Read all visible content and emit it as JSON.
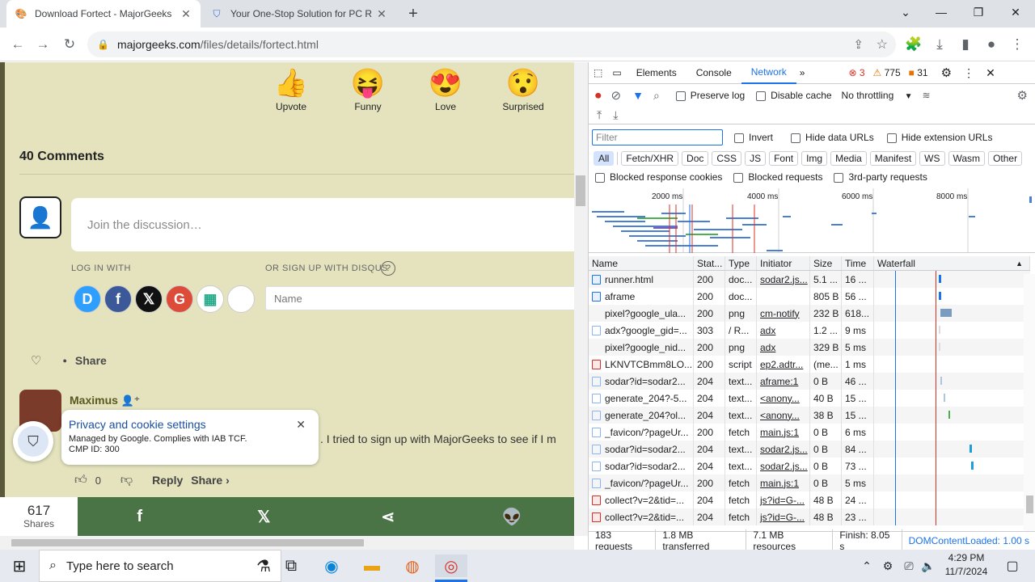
{
  "browser": {
    "tabs": [
      {
        "title": "Download Fortect - MajorGeeks",
        "active": true
      },
      {
        "title": "Your One-Stop Solution for PC R",
        "active": false
      }
    ],
    "new_tab_label": "+",
    "url_host": "majorgeeks.com",
    "url_path": "/files/details/fortect.html"
  },
  "page": {
    "reactions": [
      {
        "label": "Upvote",
        "emoji": "👍"
      },
      {
        "label": "Funny",
        "emoji": "😝"
      },
      {
        "label": "Love",
        "emoji": "😍"
      },
      {
        "label": "Surprised",
        "emoji": "😯"
      }
    ],
    "comments_title": "40 Comments",
    "join_placeholder": "Join the discussion…",
    "login_with": "LOG IN WITH",
    "signup_disqus": "OR SIGN UP WITH DISQUS",
    "help_mark": "?",
    "social": [
      {
        "label": "D",
        "color": "#2e9fff"
      },
      {
        "label": "f",
        "color": "#3b5998"
      },
      {
        "label": "𝕏",
        "color": "#111111"
      },
      {
        "label": "G",
        "color": "#dd4b39"
      },
      {
        "label": "▦",
        "color": "#ffffff"
      },
      {
        "label": "",
        "color": "#111111"
      }
    ],
    "name_placeholder": "Name",
    "share_label": "Share",
    "comment_author": "Maximus",
    "comment_text": ". I tried to sign up with MajorGeeks to see if I m",
    "vote_count": "0",
    "reply_label": "Reply",
    "share_link_label": "Share ›",
    "cookie_title": "Privacy and cookie settings",
    "cookie_sub1": "Managed by Google. Complies with IAB TCF.",
    "cookie_sub2": "CMP ID: 300",
    "share_count": "617",
    "share_count_label": "Shares",
    "share_buttons": [
      "f",
      "𝕏",
      "⋖",
      "👽"
    ]
  },
  "devtools": {
    "tabs": [
      "Elements",
      "Console",
      "Network"
    ],
    "active_tab": "Network",
    "errors": "3",
    "warnings": "775",
    "issues": "31",
    "preserve_log": "Preserve log",
    "disable_cache": "Disable cache",
    "throttling": "No throttling",
    "filter_placeholder": "Filter",
    "invert": "Invert",
    "hide_data_urls": "Hide data URLs",
    "hide_ext_urls": "Hide extension URLs",
    "type_filters": [
      "All",
      "Fetch/XHR",
      "Doc",
      "CSS",
      "JS",
      "Font",
      "Img",
      "Media",
      "Manifest",
      "WS",
      "Wasm",
      "Other"
    ],
    "blocked_response_cookies": "Blocked response cookies",
    "blocked_requests": "Blocked requests",
    "third_party": "3rd-party requests",
    "timeline_ticks": [
      "2000 ms",
      "4000 ms",
      "6000 ms",
      "8000 ms"
    ],
    "columns": [
      "Name",
      "Stat...",
      "Type",
      "Initiator",
      "Size",
      "Time",
      "Waterfall"
    ],
    "rows": [
      {
        "name": "runner.html",
        "status": "200",
        "type": "doc...",
        "initiator": "sodar2.js...",
        "size": "5.1 ...",
        "time": "16 ...",
        "icon": "doc"
      },
      {
        "name": "aframe",
        "status": "200",
        "type": "doc...",
        "initiator": "",
        "size": "805 B",
        "time": "56 ...",
        "icon": "doc"
      },
      {
        "name": "pixel?google_ula...",
        "status": "200",
        "type": "png",
        "initiator": "cm-notify",
        "size": "232 B",
        "time": "618...",
        "icon": "none"
      },
      {
        "name": "adx?google_gid=...",
        "status": "303",
        "type": "/ R...",
        "initiator": "adx",
        "size": "1.2 ...",
        "time": "9 ms",
        "icon": "file"
      },
      {
        "name": "pixel?google_nid...",
        "status": "200",
        "type": "png",
        "initiator": "adx",
        "size": "329 B",
        "time": "5 ms",
        "icon": "none"
      },
      {
        "name": "LKNVTCBmm8LO...",
        "status": "200",
        "type": "script",
        "initiator": "ep2.adtr...",
        "size": "(me...",
        "time": "1 ms",
        "icon": "err"
      },
      {
        "name": "sodar?id=sodar2...",
        "status": "204",
        "type": "text...",
        "initiator": "aframe:1",
        "size": "0 B",
        "time": "46 ...",
        "icon": "file"
      },
      {
        "name": "generate_204?-5...",
        "status": "204",
        "type": "text...",
        "initiator": "<anony...",
        "size": "40 B",
        "time": "15 ...",
        "icon": "file"
      },
      {
        "name": "generate_204?ol...",
        "status": "204",
        "type": "text...",
        "initiator": "<anony...",
        "size": "38 B",
        "time": "15 ...",
        "icon": "file"
      },
      {
        "name": "_favicon/?pageUr...",
        "status": "200",
        "type": "fetch",
        "initiator": "main.js:1",
        "size": "0 B",
        "time": "6 ms",
        "icon": "file"
      },
      {
        "name": "sodar?id=sodar2...",
        "status": "204",
        "type": "text...",
        "initiator": "sodar2.js...",
        "size": "0 B",
        "time": "84 ...",
        "icon": "file"
      },
      {
        "name": "sodar?id=sodar2...",
        "status": "204",
        "type": "text...",
        "initiator": "sodar2.js...",
        "size": "0 B",
        "time": "73 ...",
        "icon": "file"
      },
      {
        "name": "_favicon/?pageUr...",
        "status": "200",
        "type": "fetch",
        "initiator": "main.js:1",
        "size": "0 B",
        "time": "5 ms",
        "icon": "file"
      },
      {
        "name": "collect?v=2&tid=...",
        "status": "204",
        "type": "fetch",
        "initiator": "js?id=G-...",
        "size": "48 B",
        "time": "24 ...",
        "icon": "err"
      },
      {
        "name": "collect?v=2&tid=...",
        "status": "204",
        "type": "fetch",
        "initiator": "js?id=G-...",
        "size": "48 B",
        "time": "23 ...",
        "icon": "err"
      }
    ],
    "status": {
      "requests": "183 requests",
      "transferred": "1.8 MB transferred",
      "resources": "7.1 MB resources",
      "finish": "Finish: 8.05 s",
      "dcl": "DOMContentLoaded: 1.00 s"
    }
  },
  "taskbar": {
    "search_placeholder": "Type here to search",
    "time": "4:29 PM",
    "date": "11/7/2024"
  }
}
